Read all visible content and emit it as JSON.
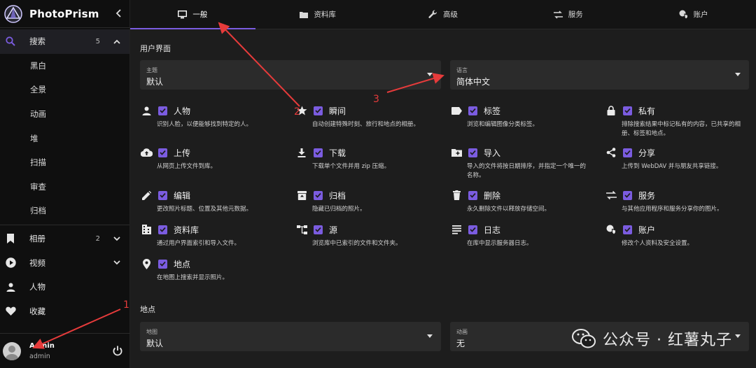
{
  "brand": {
    "title": "PhotoPrism"
  },
  "sidebar": {
    "items": [
      {
        "label": "搜索",
        "count": "5",
        "icon": "search-icon"
      },
      {
        "label": "黑白"
      },
      {
        "label": "全景"
      },
      {
        "label": "动画"
      },
      {
        "label": "堆"
      },
      {
        "label": "扫描"
      },
      {
        "label": "审查"
      },
      {
        "label": "归档"
      },
      {
        "label": "相册",
        "count": "2",
        "icon": "bookmark-icon"
      },
      {
        "label": "视频",
        "icon": "play-circle-icon"
      },
      {
        "label": "人物",
        "icon": "person-icon"
      },
      {
        "label": "收藏",
        "icon": "heart-icon"
      }
    ],
    "user": {
      "name": "Admin",
      "login": "admin"
    }
  },
  "tabs": [
    {
      "label": "一般",
      "icon": "monitor-icon"
    },
    {
      "label": "资料库",
      "icon": "library-icon"
    },
    {
      "label": "高级",
      "icon": "wrench-icon"
    },
    {
      "label": "服务",
      "icon": "swap-icon"
    },
    {
      "label": "账户",
      "icon": "account-shield-icon"
    }
  ],
  "ui_section": {
    "title": "用户界面",
    "theme": {
      "label": "主题",
      "value": "默认"
    },
    "language": {
      "label": "语言",
      "value": "简体中文"
    }
  },
  "features": [
    {
      "name": "人物",
      "desc": "识别人脸，以便能够找到特定的人。",
      "icon": "person-icon",
      "checked": true
    },
    {
      "name": "瞬间",
      "desc": "自动创建特殊时刻、旅行和地点的相册。",
      "icon": "star-icon",
      "checked": true
    },
    {
      "name": "标签",
      "desc": "浏览和编辑图像分类标签。",
      "icon": "label-icon",
      "checked": true
    },
    {
      "name": "私有",
      "desc": "排除搜索结果中标记私有的内容，已共享的相册、标签和地点。",
      "icon": "lock-icon",
      "checked": true
    },
    {
      "name": "上传",
      "desc": "从网页上传文件到库。",
      "icon": "cloud-upload-icon",
      "checked": true
    },
    {
      "name": "下载",
      "desc": "下载单个文件并用 zip 压缩。",
      "icon": "download-icon",
      "checked": true
    },
    {
      "name": "导入",
      "desc": "导入的文件将按日期排序，并指定一个唯一的名称。",
      "icon": "folder-plus-icon",
      "checked": true
    },
    {
      "name": "分享",
      "desc": "上传到 WebDAV 并与朋友共享链接。",
      "icon": "share-icon",
      "checked": true
    },
    {
      "name": "编辑",
      "desc": "更改照片标题、位置及其他元数据。",
      "icon": "pencil-icon",
      "checked": true
    },
    {
      "name": "归档",
      "desc": "隐藏已归档的照片。",
      "icon": "archive-icon",
      "checked": true
    },
    {
      "name": "删除",
      "desc": "永久删除文件以释放存储空间。",
      "icon": "trash-icon",
      "checked": true
    },
    {
      "name": "服务",
      "desc": "与其他应用程序和服务分享你的图片。",
      "icon": "swap-icon",
      "checked": true
    },
    {
      "name": "资料库",
      "desc": "通过用户界面索引和导入文件。",
      "icon": "library-icon",
      "checked": true
    },
    {
      "name": "源",
      "desc": "浏览库中已索引的文件和文件夹。",
      "icon": "sitemap-icon",
      "checked": true
    },
    {
      "name": "日志",
      "desc": "在库中显示服务器日志。",
      "icon": "text-lines-icon",
      "checked": true
    },
    {
      "name": "账户",
      "desc": "修改个人资料及安全设置。",
      "icon": "account-shield-icon",
      "checked": true
    },
    {
      "name": "地点",
      "desc": "在地图上搜索并显示照片。",
      "icon": "map-marker-icon",
      "checked": true
    }
  ],
  "places_section": {
    "title": "地点",
    "map": {
      "label": "地图",
      "value": "默认"
    },
    "animation": {
      "label": "动画",
      "value": "无"
    }
  },
  "annotations": {
    "labels": [
      "1",
      "2",
      "3"
    ],
    "color": "#e63b3b"
  },
  "watermark": {
    "text": "公众号 · 红薯丸子"
  },
  "colors": {
    "accent": "#7b5ce0",
    "background": "#1d1d1d",
    "sidebar": "#0f0f0f",
    "annotation": "#e63b3b"
  }
}
